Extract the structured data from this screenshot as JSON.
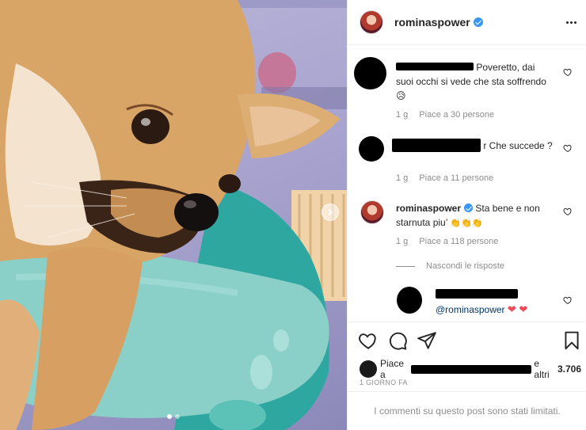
{
  "post": {
    "author": "rominaspower",
    "more_icon": "more-horizontal-icon"
  },
  "comments": [
    {
      "text": "Poveretto, dai suoi occhi si vede che sta soffrendo😥",
      "time": "1 g",
      "likes": "Piace a 30 persone"
    },
    {
      "text": "r Che succede ?",
      "time": "1 g",
      "likes": "Piace a 11 persone"
    },
    {
      "author": "rominaspower",
      "text": "Sta bene e non starnuta piu’",
      "claps": "👏👏👏",
      "time": "1 g",
      "likes": "Piace a 118 persone"
    }
  ],
  "hide_replies": "Nascondi le risposte",
  "reply": {
    "mention": "@rominaspower",
    "hearts": "❤ ❤"
  },
  "likes_summary": {
    "prefix": "Piace a",
    "suffix": "e altri",
    "count": "3.706"
  },
  "time_ago": "1 GIORNO FA",
  "comments_limited": "I commenti su questo post sono stati limitati.",
  "colors": {
    "verified": "#3897f0",
    "mention": "#00376b",
    "heart": "#ed4956",
    "muted": "#8e8e8e"
  },
  "icons": [
    "heart-icon",
    "comment-icon",
    "share-icon",
    "bookmark-icon",
    "chevron-right-icon",
    "verified-badge-icon"
  ],
  "carousel": {
    "total": 2,
    "current": 1
  }
}
